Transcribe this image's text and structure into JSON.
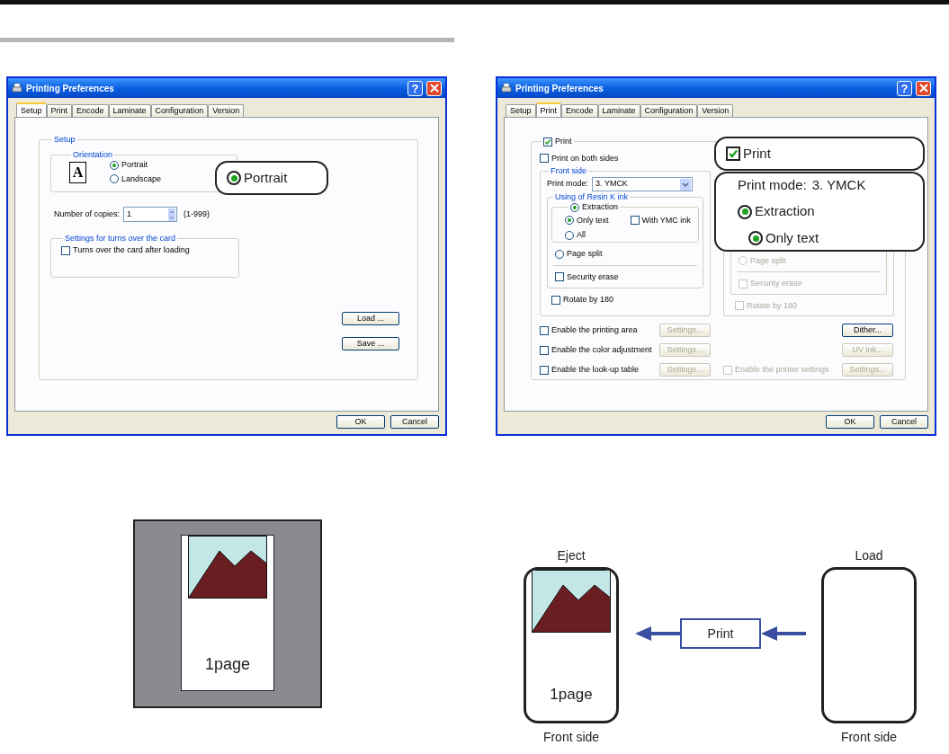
{
  "setup_dialog": {
    "title": "Printing Preferences",
    "help": "?",
    "tabs": [
      {
        "label": "Setup",
        "selected": true
      },
      {
        "label": "Print",
        "selected": false
      },
      {
        "label": "Encode",
        "selected": false
      },
      {
        "label": "Laminate",
        "selected": false
      },
      {
        "label": "Configuration",
        "selected": false
      },
      {
        "label": "Version",
        "selected": false
      }
    ],
    "setup_group": "Setup",
    "orientation_group": "Orientation",
    "orientation_sample": "A",
    "orientation": [
      {
        "label": "Portrait",
        "selected": true
      },
      {
        "label": "Landscape",
        "selected": false
      }
    ],
    "copies": {
      "label": "Number of copies:",
      "value": "1",
      "range": "(1-999)"
    },
    "turns_group": "Settings for turns over the card",
    "turns_over": {
      "label": "Turns over the card after loading",
      "checked": false
    },
    "side_buttons": [
      "Load ...",
      "Save ..."
    ],
    "callout": {
      "label": "Portrait",
      "selected": true
    },
    "buttons": [
      "OK",
      "Cancel"
    ]
  },
  "print_dialog": {
    "title": "Printing Preferences",
    "help": "?",
    "tabs": [
      {
        "label": "Setup",
        "selected": false
      },
      {
        "label": "Print",
        "selected": true
      },
      {
        "label": "Encode",
        "selected": false
      },
      {
        "label": "Laminate",
        "selected": false
      },
      {
        "label": "Configuration",
        "selected": false
      },
      {
        "label": "Version",
        "selected": false
      }
    ],
    "print": {
      "label": "Print",
      "checked": true
    },
    "both_sides": {
      "label": "Print on both sides",
      "checked": false
    },
    "front_side": {
      "title": "Front side",
      "print_mode_label": "Print mode:",
      "print_mode": "3. YMCK",
      "resin_group": "Using of Resin K ink",
      "extraction": {
        "label": "Extraction",
        "selected": true
      },
      "only_text": {
        "label": "Only text",
        "selected": true
      },
      "with_ymc": {
        "label": "With YMC ink",
        "checked": false
      },
      "all": {
        "label": "All",
        "selected": false
      },
      "page_split": {
        "label": "Page split",
        "selected": false
      },
      "security_erase": {
        "label": "Security erase",
        "checked": false
      },
      "rotate": {
        "label": "Rotate by 180",
        "checked": false
      }
    },
    "back_side": {
      "disabled": true,
      "page_split": {
        "label": "Page split",
        "selected": false
      },
      "security_erase": {
        "label": "Security erase",
        "checked": false
      },
      "rotate": {
        "label": "Rotate by 180",
        "checked": false
      }
    },
    "options": [
      {
        "label": "Enable the printing area",
        "checked": false,
        "button": {
          "label": "Settings...",
          "disabled": true
        }
      },
      {
        "label": "Enable the color adjustment",
        "checked": false,
        "button": {
          "label": "Settings...",
          "disabled": true
        }
      },
      {
        "label": "Enable the look-up table",
        "checked": false,
        "button": {
          "label": "Settings...",
          "disabled": true
        }
      }
    ],
    "right_buttons": [
      {
        "label": "Dither...",
        "disabled": false
      },
      {
        "label": "UV ink...",
        "disabled": true
      }
    ],
    "printer_settings": {
      "label": "Enable the printer settings",
      "checked": false,
      "disabled": true,
      "button": {
        "label": "Settings...",
        "disabled": true
      }
    },
    "callout_print": {
      "label": "Print",
      "checked": true
    },
    "callout_mode": {
      "label": "Print mode:",
      "value": "3. YMCK",
      "extraction": {
        "label": "Extraction",
        "selected": true
      },
      "only_text": {
        "label": "Only text",
        "selected": true
      }
    },
    "buttons": [
      "OK",
      "Cancel"
    ]
  },
  "single_side_figure": {
    "card_text": "1page"
  },
  "flow_figure": {
    "eject_label": "Eject",
    "eject_card_text": "1page",
    "eject_side": "Front side",
    "process": "Print",
    "load_label": "Load",
    "load_side": "Front side"
  }
}
